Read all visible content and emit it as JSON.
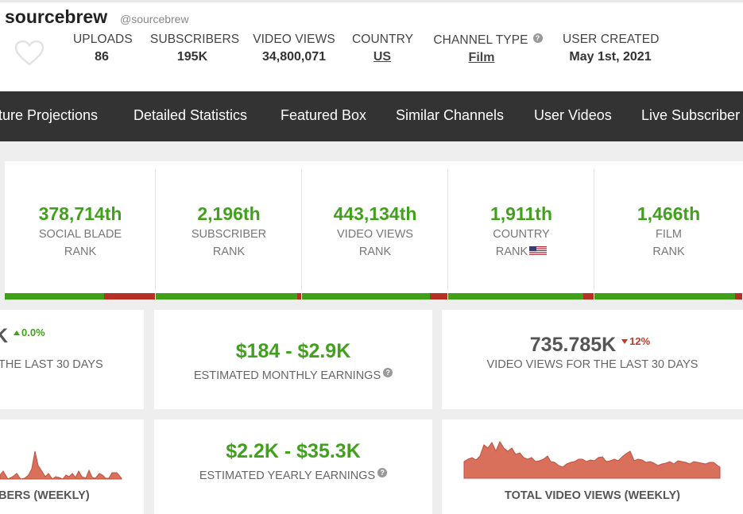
{
  "header": {
    "channel_name": "sourcebrew",
    "handle": "@sourcebrew",
    "stats": [
      {
        "label": "UPLOADS",
        "value": "86"
      },
      {
        "label": "SUBSCRIBERS",
        "value": "195K"
      },
      {
        "label": "VIDEO VIEWS",
        "value": "34,800,071"
      },
      {
        "label": "COUNTRY",
        "value": "US"
      },
      {
        "label": "CHANNEL TYPE",
        "value": "Film"
      },
      {
        "label": "USER CREATED",
        "value": "May 1st, 2021"
      }
    ],
    "help_glyph": "?"
  },
  "nav": {
    "items": [
      "ture Projections",
      "Detailed Statistics",
      "Featured Box",
      "Similar Channels",
      "User Videos",
      "Live Subscriber"
    ]
  },
  "ranks": [
    {
      "value": "378,714th",
      "line1": "SOCIAL BLADE",
      "line2": "RANK",
      "fill": 0.66
    },
    {
      "value": "2,196th",
      "line1": "SUBSCRIBER",
      "line2": "RANK",
      "fill": 0.97
    },
    {
      "value": "443,134th",
      "line1": "VIDEO VIEWS",
      "line2": "RANK",
      "fill": 0.88
    },
    {
      "value": "1,911th",
      "line1": "COUNTRY",
      "line2": "RANK",
      "fill": 0.93,
      "flag": "us-flag-icon"
    },
    {
      "value": "1,466th",
      "line1": "FILM",
      "line2": "RANK",
      "fill": 0.95
    }
  ],
  "cards": {
    "subs_30": {
      "value": "K",
      "change": "0.0%",
      "label": "THE LAST 30 DAYS"
    },
    "monthly": {
      "value": "$184  -  $2.9K",
      "label": "ESTIMATED MONTHLY EARNINGS"
    },
    "views_30": {
      "value": "735.785K",
      "change": "12%",
      "label": "VIDEO VIEWS FOR THE LAST 30 DAYS"
    },
    "yearly": {
      "value": "$2.2K  -  $35.3K",
      "label": "ESTIMATED YEARLY EARNINGS"
    },
    "subs_chart_label": "BERS (WEEKLY)",
    "views_chart_label": "TOTAL VIDEO VIEWS (WEEKLY)"
  },
  "colors": {
    "green": "#41a11c",
    "red": "#b63024",
    "nav_bg": "#333333",
    "chart_fill": "#d9705c"
  }
}
